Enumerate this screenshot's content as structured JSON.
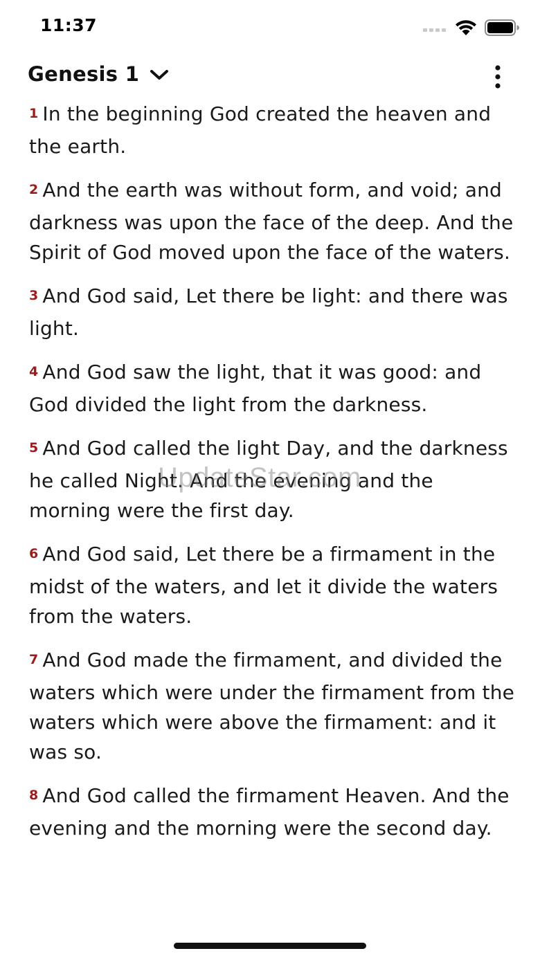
{
  "status_bar": {
    "time": "11:37",
    "wifi_icon": "wifi-icon",
    "battery_icon": "battery-icon"
  },
  "header": {
    "book_title": "Genesis 1",
    "selector_icon": "chevron-down-icon",
    "menu_icon": "more-vertical-icon"
  },
  "colors": {
    "verse_number": "#9b1c1c",
    "text": "#1a1a1a",
    "background": "#ffffff"
  },
  "verses": [
    {
      "number": "1",
      "text": "In the beginning God created the heaven and the earth."
    },
    {
      "number": "2",
      "text": "And the earth was without form, and void; and darkness was upon the face of the deep. And the Spirit of God moved upon the face of the waters."
    },
    {
      "number": "3",
      "text": "And God said, Let there be light: and there was light."
    },
    {
      "number": "4",
      "text": "And God saw the light, that it was good: and God divided the light from the darkness."
    },
    {
      "number": "5",
      "text": "And God called the light Day, and the darkness he called Night. And the evening and the morning were the first day."
    },
    {
      "number": "6",
      "text": "And God said, Let there be a firmament in the midst of the waters, and let it divide the waters from the waters."
    },
    {
      "number": "7",
      "text": "And God made the firmament, and divided the waters which were under the firmament from the waters which were above the firmament: and it was so."
    },
    {
      "number": "8",
      "text": "And God called the firmament Heaven. And the evening and the morning were the second day."
    }
  ],
  "watermark": "UpdateStar.com"
}
